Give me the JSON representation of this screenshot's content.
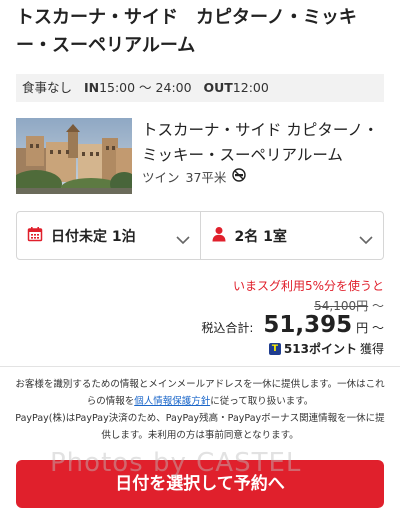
{
  "header": {
    "title": "トスカーナ・サイド　カピターノ・ミッキー・スーペリアルーム"
  },
  "plan_info": {
    "meal": "食事なし",
    "in_label": "IN",
    "in_time": "15:00 〜 24:00",
    "out_label": "OUT",
    "out_time": "12:00"
  },
  "room": {
    "name": "トスカーナ・サイド カピターノ・ミッキー・スーペリアルーム",
    "type": "ツイン",
    "size": "37平米",
    "smoking_icon": "no-smoking-icon"
  },
  "selectors": {
    "date_label": "日付未定 1泊",
    "date_icon": "calendar-icon",
    "guests_label": "2名 1室",
    "guests_icon": "person-icon"
  },
  "pricing": {
    "promo": "いまスグ利用5%分を使うと",
    "original_price": "54,100円",
    "original_suffix": "〜",
    "total_label": "税込合計:",
    "total_value": "51,395",
    "total_unit": "円 〜",
    "points_icon_text": "T",
    "points": "513ポイント",
    "points_suffix": "獲得"
  },
  "disclaimer": {
    "line1": "お客様を識別するための情報とメインメールアドレスを一休に提供します。一休はこれらの情報を",
    "link": "個人情報保護方針",
    "line1_end": "に従って取り扱います。",
    "line2": "PayPay(株)はPayPay決済のため、PayPay残高・PayPayボーナス関連情報を一休に提供します。未利用の方は事前同意となります。"
  },
  "watermark": "Photos by CASTEL",
  "cta": {
    "label": "日付を選択して予約へ"
  },
  "colors": {
    "accent": "#e0202c",
    "link": "#1a66c9"
  }
}
